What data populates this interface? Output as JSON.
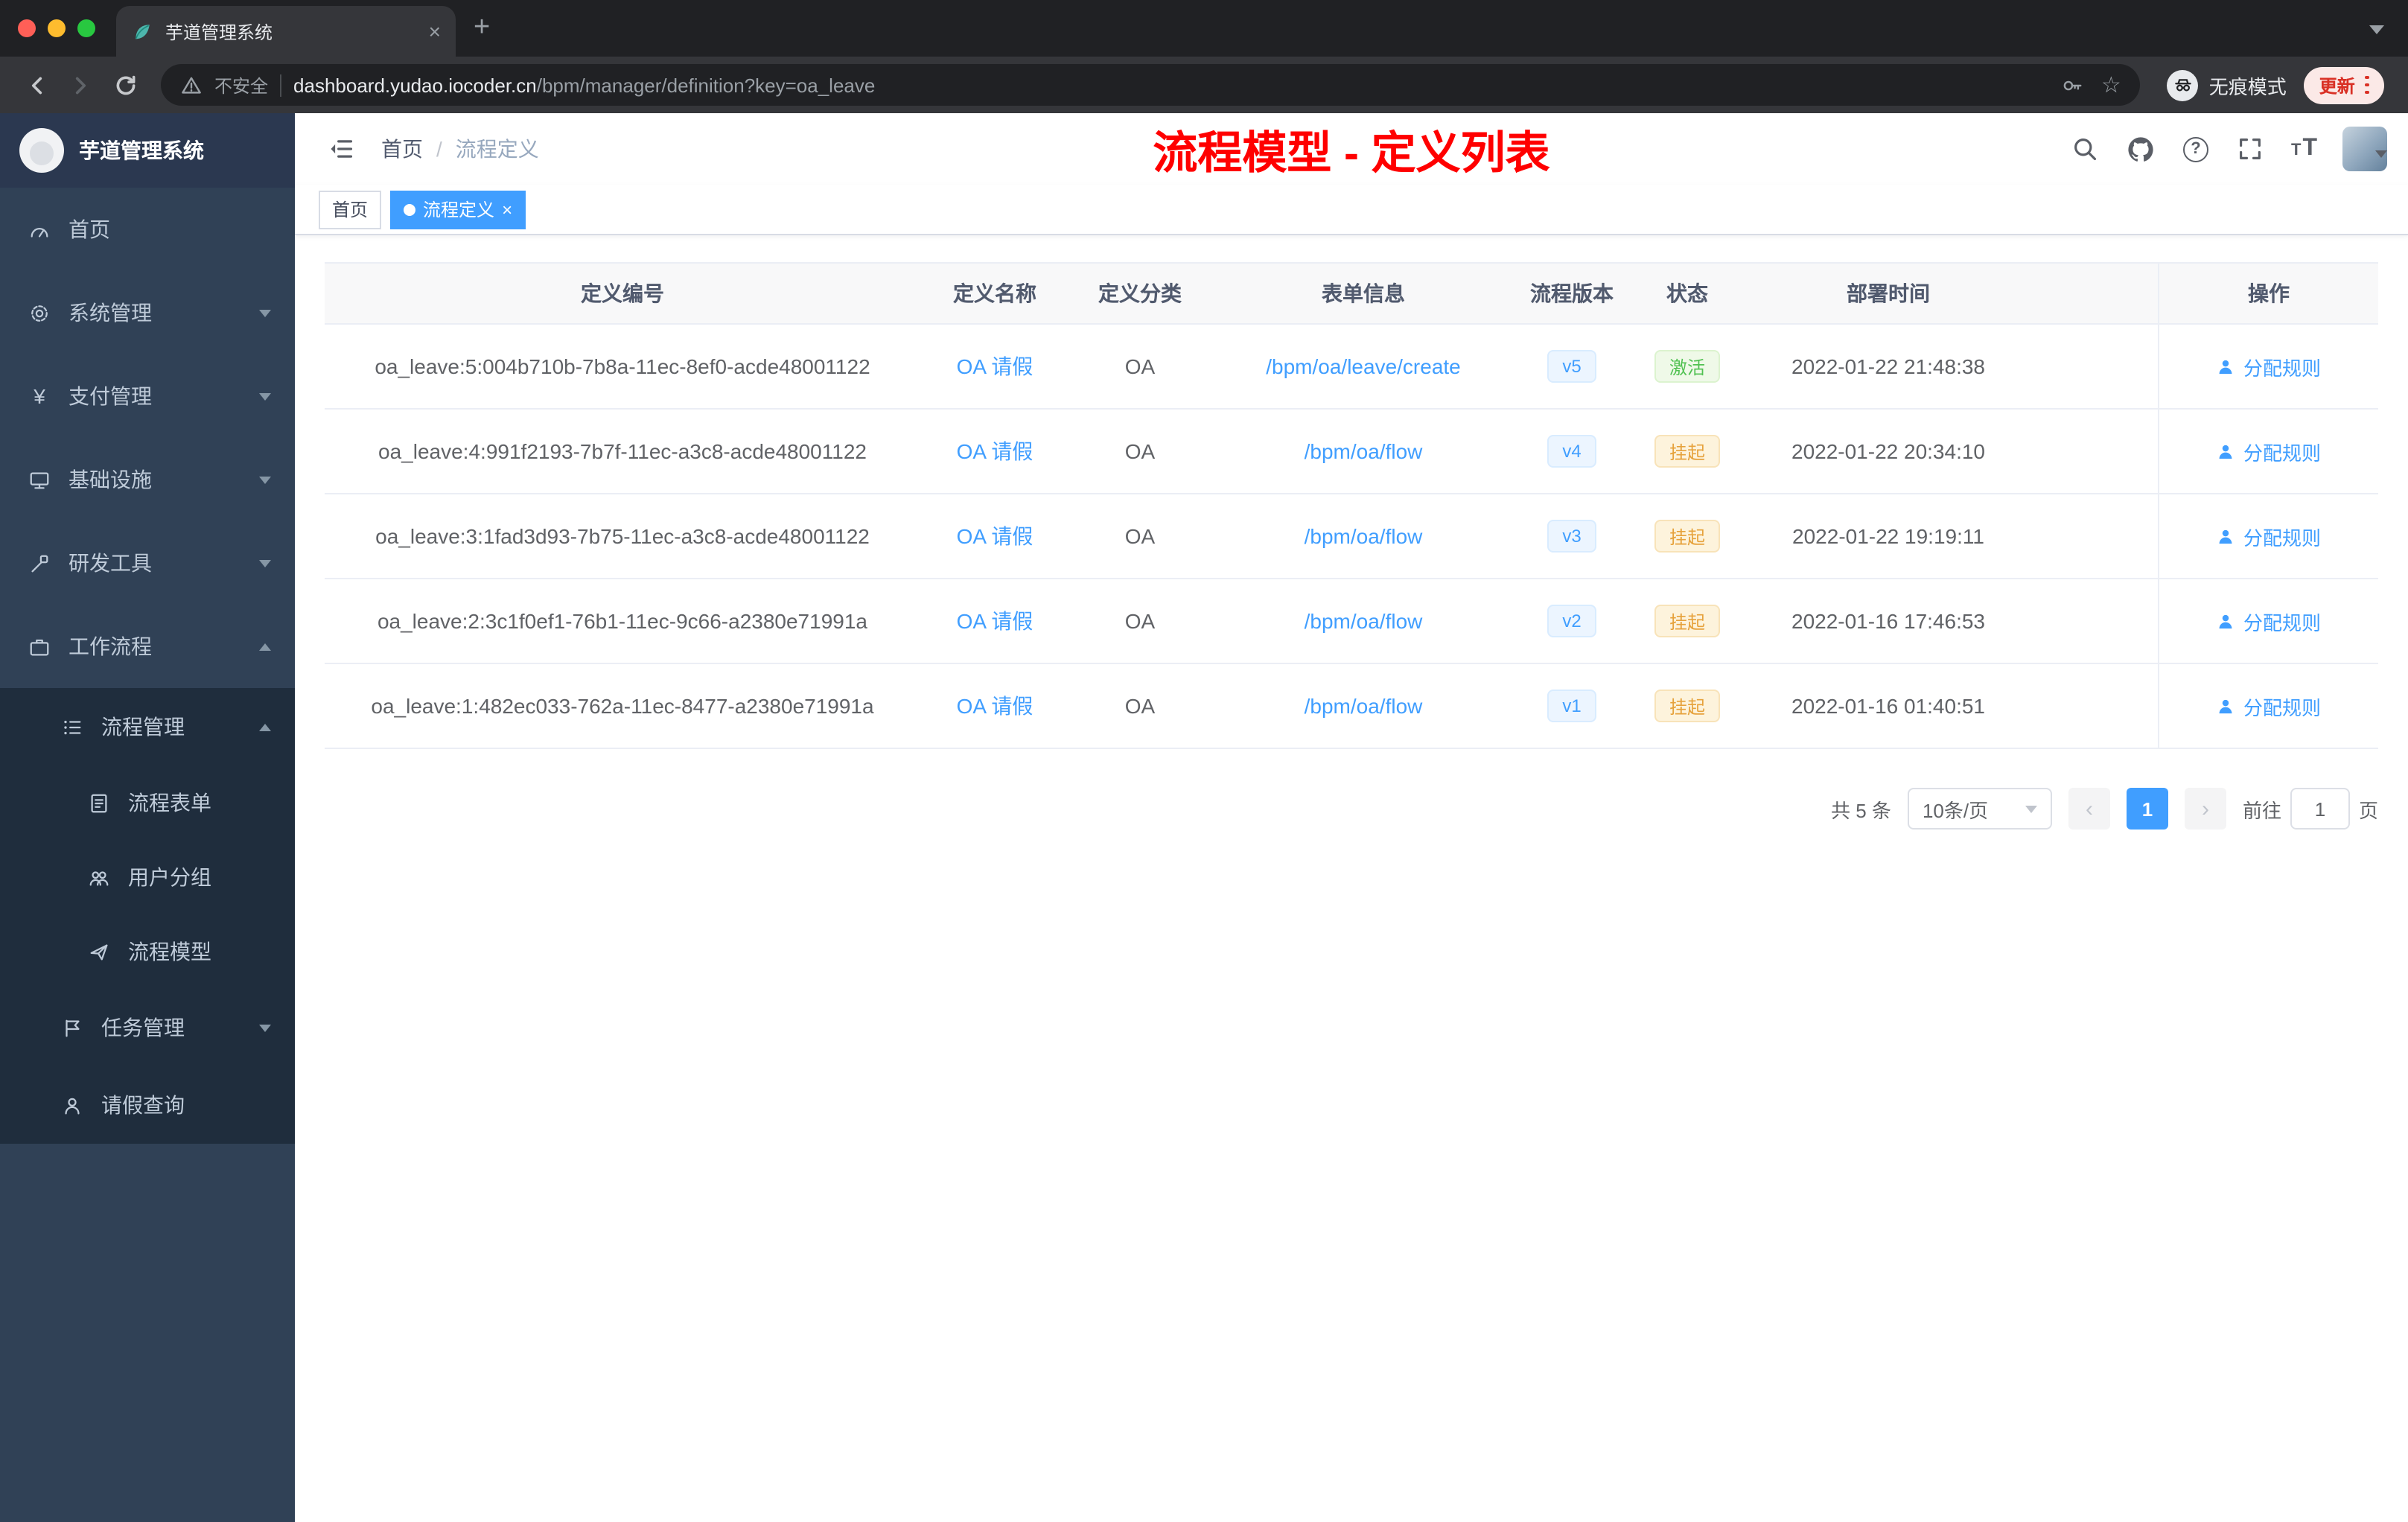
{
  "icons": {
    "close": "×",
    "add": "+",
    "star": "☆",
    "question": "?",
    "prev": "‹",
    "next": "›",
    "breadcrumb_separator": "/",
    "size_small": "T",
    "size_large": "T"
  },
  "browser": {
    "tab_title": "芋道管理系统",
    "security_label": "不安全",
    "url_domain": "dashboard.yudao.iocoder.cn",
    "url_path": "/bpm/manager/definition?key=oa_leave",
    "incognito_label": "无痕模式",
    "update_label": "更新"
  },
  "sidebar": {
    "logo_title": "芋道管理系统",
    "items": [
      {
        "label": "首页"
      },
      {
        "label": "系统管理"
      },
      {
        "label": "支付管理"
      },
      {
        "label": "基础设施"
      },
      {
        "label": "研发工具"
      },
      {
        "label": "工作流程"
      },
      {
        "label": "流程管理"
      },
      {
        "label": "流程表单"
      },
      {
        "label": "用户分组"
      },
      {
        "label": "流程模型"
      },
      {
        "label": "任务管理"
      },
      {
        "label": "请假查询"
      }
    ]
  },
  "header": {
    "breadcrumb": [
      "首页",
      "流程定义"
    ],
    "annotation": "流程模型 - 定义列表"
  },
  "tags": [
    {
      "label": "首页"
    },
    {
      "label": "流程定义"
    }
  ],
  "table": {
    "columns": [
      "定义编号",
      "定义名称",
      "定义分类",
      "表单信息",
      "流程版本",
      "状态",
      "部署时间",
      "操作"
    ],
    "rows": [
      {
        "id": "oa_leave:5:004b710b-7b8a-11ec-8ef0-acde48001122",
        "name": "OA 请假",
        "category": "OA",
        "form": "/bpm/oa/leave/create",
        "version": "v5",
        "status": "激活",
        "time": "2022-01-22 21:48:38",
        "action": "分配规则"
      },
      {
        "id": "oa_leave:4:991f2193-7b7f-11ec-a3c8-acde48001122",
        "name": "OA 请假",
        "category": "OA",
        "form": "/bpm/oa/flow",
        "version": "v4",
        "status": "挂起",
        "time": "2022-01-22 20:34:10",
        "action": "分配规则"
      },
      {
        "id": "oa_leave:3:1fad3d93-7b75-11ec-a3c8-acde48001122",
        "name": "OA 请假",
        "category": "OA",
        "form": "/bpm/oa/flow",
        "version": "v3",
        "status": "挂起",
        "time": "2022-01-22 19:19:11",
        "action": "分配规则"
      },
      {
        "id": "oa_leave:2:3c1f0ef1-76b1-11ec-9c66-a2380e71991a",
        "name": "OA 请假",
        "category": "OA",
        "form": "/bpm/oa/flow",
        "version": "v2",
        "status": "挂起",
        "time": "2022-01-16 17:46:53",
        "action": "分配规则"
      },
      {
        "id": "oa_leave:1:482ec033-762a-11ec-8477-a2380e71991a",
        "name": "OA 请假",
        "category": "OA",
        "form": "/bpm/oa/flow",
        "version": "v1",
        "status": "挂起",
        "time": "2022-01-16 01:40:51",
        "action": "分配规则"
      }
    ]
  },
  "pagination": {
    "total": "共 5 条",
    "page_size": "10条/页",
    "page": "1",
    "goto_label": "前往",
    "goto_value": "1",
    "unit_label": "页"
  },
  "colors": {
    "accent": "#409eff",
    "success": "#51c152",
    "warning": "#e6a23c",
    "annotation": "#ff0000",
    "sidebar_bg": "#304156",
    "submenu_bg": "#1f2d3d"
  }
}
